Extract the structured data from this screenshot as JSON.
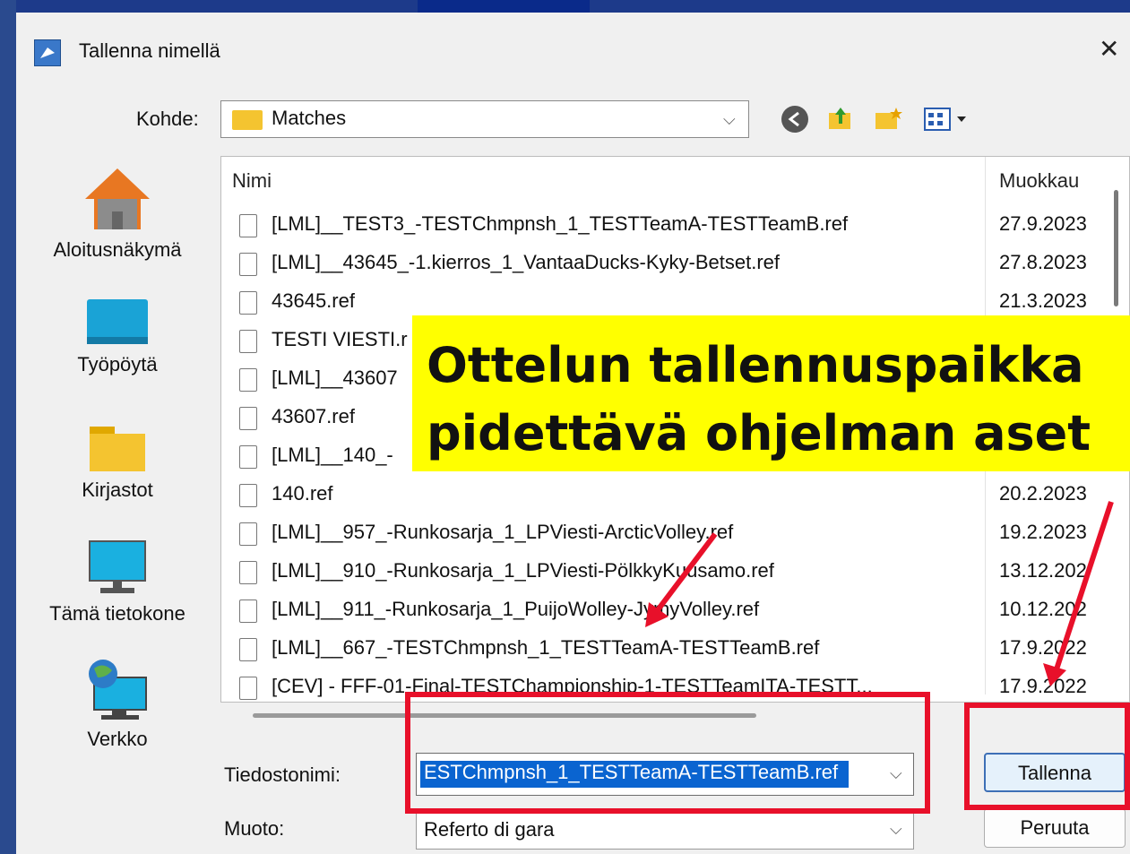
{
  "window": {
    "title": "Tallenna nimellä",
    "close": "✕"
  },
  "location": {
    "label": "Kohde:",
    "value": "Matches"
  },
  "places": [
    {
      "label": "Aloitusnäkymä",
      "icon": "home-icon"
    },
    {
      "label": "Työpöytä",
      "icon": "desktop-icon"
    },
    {
      "label": "Kirjastot",
      "icon": "folder-icon"
    },
    {
      "label": "Tämä tietokone",
      "icon": "computer-icon"
    },
    {
      "label": "Verkko",
      "icon": "network-icon"
    }
  ],
  "columns": {
    "name": "Nimi",
    "modified": "Muokkau"
  },
  "files": [
    {
      "name": "[LML]__TEST3_-TESTChmpnsh_1_TESTTeamA-TESTTeamB.ref",
      "date": "27.9.2023"
    },
    {
      "name": "[LML]__43645_-1.kierros_1_VantaaDucks-Kyky-Betset.ref",
      "date": "27.8.2023"
    },
    {
      "name": "43645.ref",
      "date": "21.3.2023"
    },
    {
      "name": "TESTI VIESTI.r",
      "date": ""
    },
    {
      "name": "[LML]__43607",
      "date": ""
    },
    {
      "name": "43607.ref",
      "date": ""
    },
    {
      "name": "[LML]__140_-",
      "date": ""
    },
    {
      "name": "140.ref",
      "date": "20.2.2023"
    },
    {
      "name": "[LML]__957_-Runkosarja_1_LPViesti-ArcticVolley.ref",
      "date": "19.2.2023"
    },
    {
      "name": "[LML]__910_-Runkosarja_1_LPViesti-PölkkyKuusamo.ref",
      "date": "13.12.202"
    },
    {
      "name": "[LML]__911_-Runkosarja_1_PuijoWolley-JymyVolley.ref",
      "date": "10.12.202"
    },
    {
      "name": "[LML]__667_-TESTChmpnsh_1_TESTTeamA-TESTTeamB.ref",
      "date": "17.9.2022"
    },
    {
      "name": "[CEV] - FFF-01-Final-TESTChampionship-1-TESTTeamITA-TESTT...",
      "date": "17.9.2022"
    }
  ],
  "filename": {
    "label": "Tiedostonimi:",
    "value": "ESTChmpnsh_1_TESTTeamA-TESTTeamB.ref"
  },
  "format": {
    "label": "Muoto:",
    "value": "Referto di gara"
  },
  "buttons": {
    "save": "Tallenna",
    "cancel": "Peruuta"
  },
  "callout": {
    "line1": "Ottelun tallennuspaikka",
    "line2": "pidettävä ohjelman aset"
  },
  "colors": {
    "accent": "#0a64d0",
    "highlight": "#ffff00",
    "annotation": "#e8102a"
  }
}
